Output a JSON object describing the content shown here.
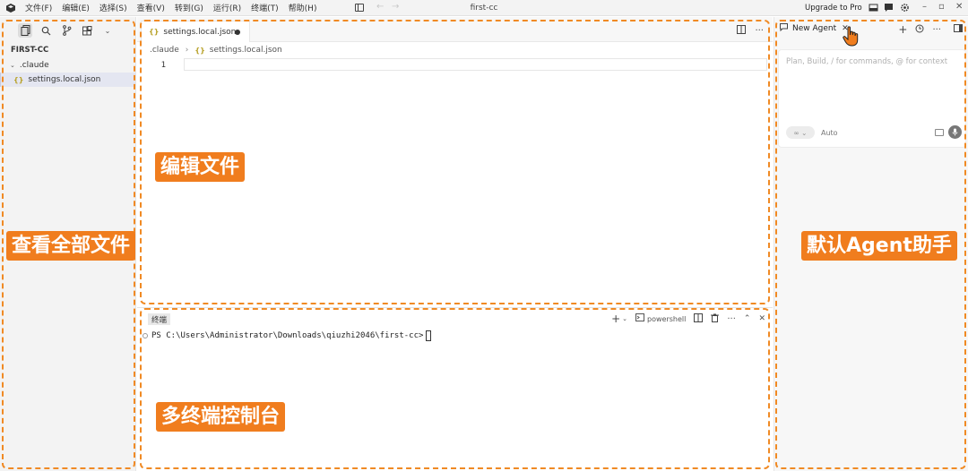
{
  "titlebar": {
    "menus": [
      "文件(F)",
      "编辑(E)",
      "选择(S)",
      "查看(V)",
      "转到(G)",
      "运行(R)",
      "终端(T)",
      "帮助(H)"
    ],
    "title": "first-cc",
    "upgrade_label": "Upgrade to Pro"
  },
  "sidebar": {
    "explorer_title": "FIRST-CC",
    "folder": ".claude",
    "file": "settings.local.json"
  },
  "editor": {
    "tab_label": "settings.local.json",
    "breadcrumb": [
      ".claude",
      "settings.local.json"
    ],
    "line_numbers": [
      "1"
    ]
  },
  "terminal": {
    "tab_label": "终端",
    "shell_label": "powershell",
    "prompt": "PS C:\\Users\\Administrator\\Downloads\\qiuzhi2046\\first-cc>"
  },
  "agent": {
    "tab_label": "New Agent",
    "placeholder": "Plan, Build, / for commands, @ for context",
    "mode_glyph": "∞ ⌄",
    "model_label": "Auto"
  },
  "annotations": {
    "files": "查看全部文件",
    "editor": "编辑文件",
    "terminal": "多终端控制台",
    "agent": "默认Agent助手"
  },
  "colors": {
    "accent_orange": "#f07d1e",
    "frame_orange": "#f08a24",
    "json_icon": "#b8a22a"
  }
}
